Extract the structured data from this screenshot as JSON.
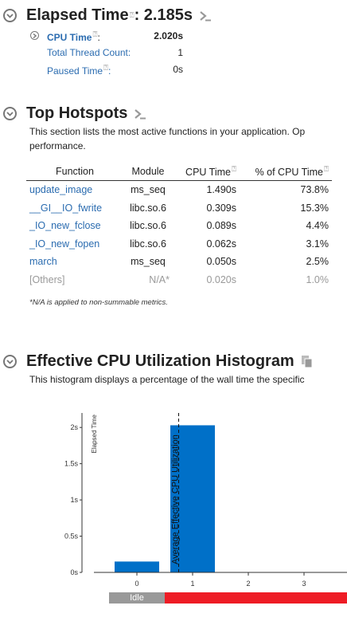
{
  "elapsed": {
    "title": "Elapsed Time",
    "value": ": 2.185s",
    "metrics": [
      {
        "label": "CPU Time",
        "suffix": ":",
        "value": "2.020s"
      },
      {
        "label": "Total Thread Count",
        "suffix": ":",
        "value": "1"
      },
      {
        "label": "Paused Time",
        "suffix": ":",
        "value": "0s"
      }
    ]
  },
  "hotspots": {
    "title": "Top Hotspots",
    "description_line1": "This section lists the most active functions in your application. Op",
    "description_line2": "performance.",
    "columns": [
      "Function",
      "Module",
      "CPU Time",
      "% of CPU Time"
    ],
    "rows": [
      {
        "function": "update_image",
        "module": "ms_seq",
        "cpu_time": "1.490s",
        "percent": "73.8%"
      },
      {
        "function": "__GI__IO_fwrite",
        "module": "libc.so.6",
        "cpu_time": "0.309s",
        "percent": "15.3%"
      },
      {
        "function": "_IO_new_fclose",
        "module": "libc.so.6",
        "cpu_time": "0.089s",
        "percent": "4.4%"
      },
      {
        "function": "_IO_new_fopen",
        "module": "libc.so.6",
        "cpu_time": "0.062s",
        "percent": "3.1%"
      },
      {
        "function": "march",
        "module": "ms_seq",
        "cpu_time": "0.050s",
        "percent": "2.5%"
      },
      {
        "function": "[Others]",
        "module": "N/A*",
        "cpu_time": "0.020s",
        "percent": "1.0%"
      }
    ],
    "note": "*N/A is applied to non-summable metrics."
  },
  "histogram": {
    "title": "Effective CPU Utilization Histogram",
    "description": "This histogram displays a percentage of the wall time the specific",
    "idle_label": "Idle"
  },
  "chart_data": {
    "type": "bar",
    "ylabel": "Elapsed Time",
    "categories": [
      "0",
      "1",
      "2",
      "3"
    ],
    "values": [
      0.15,
      2.03,
      0,
      0
    ],
    "ylim": [
      0,
      2.2
    ],
    "yticks": [
      "0s",
      "0.5s",
      "1s",
      "1.5s",
      "2s"
    ],
    "ytick_values": [
      0,
      0.5,
      1,
      1.5,
      2
    ],
    "average_marker": {
      "label": "Average Effective CPU Utilization",
      "x": 1.05
    },
    "bar_color": "#0070c8",
    "idle_color": "#999999",
    "poor_color": "#ee1c25"
  }
}
